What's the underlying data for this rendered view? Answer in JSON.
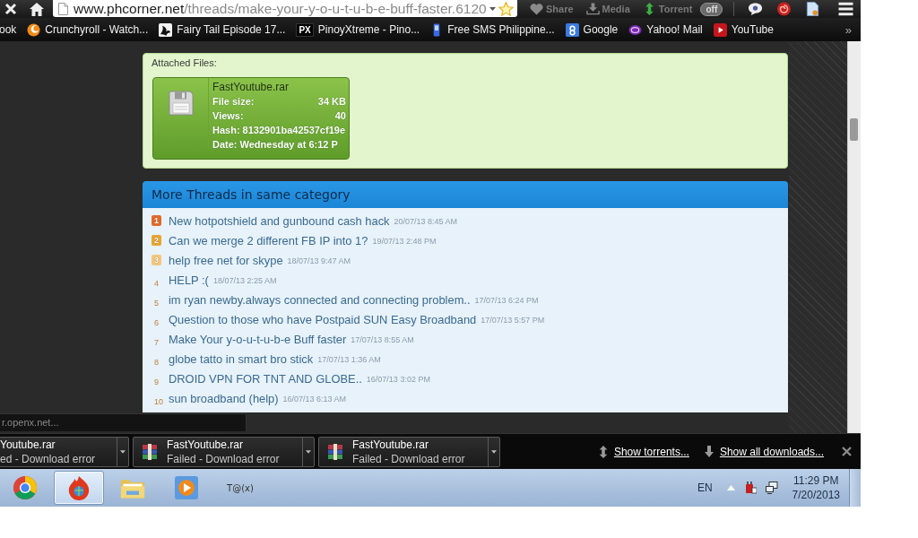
{
  "toolbar": {
    "address": {
      "host": "www.phcorner.net",
      "path": "/threads/make-your-y-o-u-t-u-b-e-buff-faster.6120"
    },
    "extensions": [
      {
        "label": "Share"
      },
      {
        "label": "Media"
      },
      {
        "label": "Torrent",
        "switch": {
          "label": "off",
          "on": false
        }
      }
    ]
  },
  "bookmarks": [
    {
      "label": "ook"
    },
    {
      "label": "Crunchyroll - Watch..."
    },
    {
      "label": "Fairy Tail Episode 17..."
    },
    {
      "label": "PinoyXtreme - Pino...",
      "favicon_text": "PX"
    },
    {
      "label": "Free SMS Philippine..."
    },
    {
      "label": "Google"
    },
    {
      "label": "Yahoo! Mail"
    },
    {
      "label": "YouTube"
    }
  ],
  "bookmarks_more": "»",
  "attachments": {
    "title": "Attached Files:",
    "file": {
      "name": "FastYoutube.rar",
      "fields": [
        {
          "label": "File size:",
          "value": "34 KB"
        },
        {
          "label": "Views:",
          "value": "40"
        }
      ],
      "lines": [
        "Hash: 8132901ba42537cf19e",
        "Date: Wednesday at 6:12 P"
      ]
    }
  },
  "more_threads": {
    "title": "More Threads in same category",
    "threads": [
      {
        "number": "1",
        "title": "New hotpotshield and gunbound cash hack",
        "date": "20/07/13 8:45 AM",
        "color": "#e06a2a"
      },
      {
        "number": "2",
        "title": "Can we merge 2 different FB IP into 1?",
        "date": "19/07/13 2:48 PM",
        "color": "#e8a432"
      },
      {
        "number": "3",
        "title": "help free net for skype",
        "date": "18/07/13 9:47 AM",
        "color": "#f2c77a"
      },
      {
        "number": "4",
        "title": "HELP :(",
        "date": "18/07/13 2:25 AM"
      },
      {
        "number": "5",
        "title": "im ryan newby.always connected and connecting problem..",
        "date": "17/07/13 6:24 PM"
      },
      {
        "number": "6",
        "title": "Question to those who have Postpaid SUN Easy Broadband",
        "date": "17/07/13 5:57 PM"
      },
      {
        "number": "7",
        "title": "Make Your y-o-u-t-u-b-e Buff faster",
        "date": "17/07/13 8:55 AM"
      },
      {
        "number": "8",
        "title": "globe tatto in smart bro stick",
        "date": "17/07/13 1:36 AM"
      },
      {
        "number": "9",
        "title": "DROID VPN FOR TNT AND GLOBE..",
        "date": "16/07/13 3:02 PM"
      },
      {
        "number": "10",
        "title": "sun broadband (help)",
        "date": "16/07/13 6:13 AM"
      }
    ]
  },
  "status_bubble": "r.openx.net...",
  "downloads": {
    "items": [
      {
        "kind": "clipped",
        "name": "Youtube.rar",
        "status": "ed - Download error"
      },
      {
        "kind": "full",
        "name": "FastYoutube.rar",
        "status": "Failed - Download error"
      },
      {
        "kind": "full",
        "name": "FastYoutube.rar",
        "status": "Failed - Download error"
      }
    ],
    "actions": [
      "Show torrents...",
      "Show all downloads..."
    ]
  },
  "taskbar": {
    "apps": [
      {
        "selected": false
      },
      {
        "selected": true
      },
      {
        "selected": false
      },
      {
        "selected": false
      },
      {
        "selected": false,
        "label": "T@(x)"
      }
    ],
    "language": "EN",
    "time": "11:29 PM",
    "date": "7/20/2013"
  }
}
